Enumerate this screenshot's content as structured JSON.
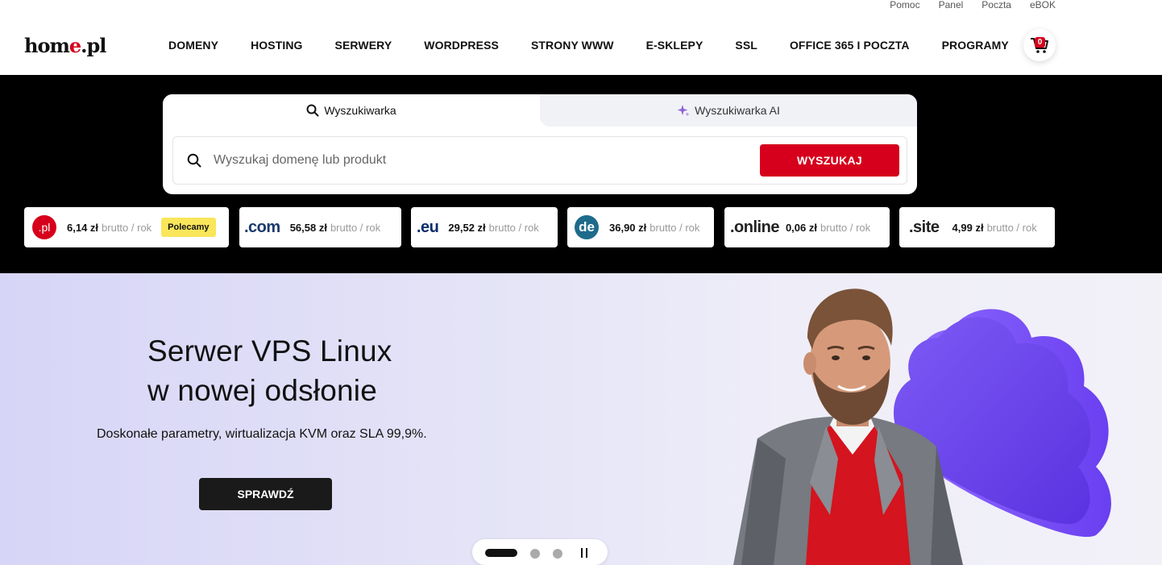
{
  "utility_links": [
    "Pomoc",
    "Panel",
    "Poczta",
    "eBOK"
  ],
  "logo": {
    "part1": "hom",
    "part2": "e",
    "part3": ".pl"
  },
  "nav": [
    "DOMENY",
    "HOSTING",
    "SERWERY",
    "WORDPRESS",
    "STRONY WWW",
    "E-SKLEPY",
    "SSL",
    "OFFICE 365 I POCZTA",
    "PROGRAMY"
  ],
  "cart": {
    "count": "0"
  },
  "search": {
    "tab_standard": "Wyszukiwarka",
    "tab_ai": "Wyszukiwarka AI",
    "placeholder": "Wyszukaj domenę lub produkt",
    "button": "WYSZUKAJ"
  },
  "tlds": [
    {
      "logo": ".pl",
      "price": "6,14 zł",
      "unit": "brutto / rok",
      "badge": "Polecamy"
    },
    {
      "logo": ".com",
      "price": "56,58 zł",
      "unit": "brutto / rok"
    },
    {
      "logo": ".eu",
      "price": "29,52 zł",
      "unit": "brutto / rok"
    },
    {
      "logo": "de",
      "price": "36,90 zł",
      "unit": "brutto / rok"
    },
    {
      "logo": ".online",
      "price": "0,06 zł",
      "unit": "brutto / rok"
    },
    {
      "logo": ".site",
      "price": "4,99 zł",
      "unit": "brutto / rok"
    }
  ],
  "hero": {
    "title_line1": "Serwer VPS Linux",
    "title_line2": "w nowej odsłonie",
    "subtitle": "Doskonałe parametry, wirtualizacja KVM oraz SLA 99,9%.",
    "cta": "SPRAWDŹ"
  },
  "colors": {
    "brand_red": "#d6001c",
    "black": "#000000",
    "hero_bg": "#e4e3f7",
    "badge_yellow": "#f9e65a",
    "cloud_purple": "#6b45f0"
  },
  "icons": [
    "search-icon",
    "sparkle-icon",
    "cart-icon",
    "pause-icon"
  ]
}
